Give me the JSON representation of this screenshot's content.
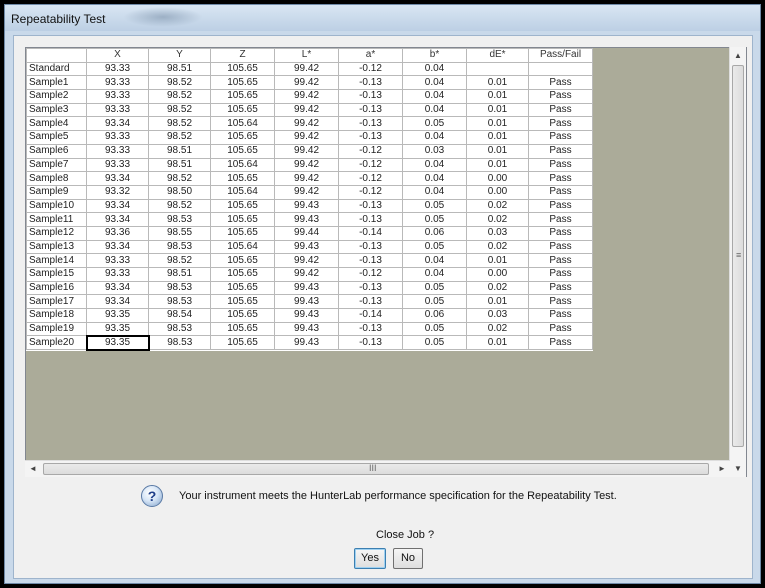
{
  "window": {
    "title": "Repeatability Test"
  },
  "table": {
    "columns": [
      "X",
      "Y",
      "Z",
      "L*",
      "a*",
      "b*",
      "dE*",
      "Pass/Fail"
    ],
    "rows": [
      {
        "label": "Standard",
        "cells": [
          "93.33",
          "98.51",
          "105.65",
          "99.42",
          "-0.12",
          "0.04",
          "",
          ""
        ]
      },
      {
        "label": "Sample1",
        "cells": [
          "93.33",
          "98.52",
          "105.65",
          "99.42",
          "-0.13",
          "0.04",
          "0.01",
          "Pass"
        ]
      },
      {
        "label": "Sample2",
        "cells": [
          "93.33",
          "98.52",
          "105.65",
          "99.42",
          "-0.13",
          "0.04",
          "0.01",
          "Pass"
        ]
      },
      {
        "label": "Sample3",
        "cells": [
          "93.33",
          "98.52",
          "105.65",
          "99.42",
          "-0.13",
          "0.04",
          "0.01",
          "Pass"
        ]
      },
      {
        "label": "Sample4",
        "cells": [
          "93.34",
          "98.52",
          "105.64",
          "99.42",
          "-0.13",
          "0.05",
          "0.01",
          "Pass"
        ]
      },
      {
        "label": "Sample5",
        "cells": [
          "93.33",
          "98.52",
          "105.65",
          "99.42",
          "-0.13",
          "0.04",
          "0.01",
          "Pass"
        ]
      },
      {
        "label": "Sample6",
        "cells": [
          "93.33",
          "98.51",
          "105.65",
          "99.42",
          "-0.12",
          "0.03",
          "0.01",
          "Pass"
        ]
      },
      {
        "label": "Sample7",
        "cells": [
          "93.33",
          "98.51",
          "105.64",
          "99.42",
          "-0.12",
          "0.04",
          "0.01",
          "Pass"
        ]
      },
      {
        "label": "Sample8",
        "cells": [
          "93.34",
          "98.52",
          "105.65",
          "99.42",
          "-0.12",
          "0.04",
          "0.00",
          "Pass"
        ]
      },
      {
        "label": "Sample9",
        "cells": [
          "93.32",
          "98.50",
          "105.64",
          "99.42",
          "-0.12",
          "0.04",
          "0.00",
          "Pass"
        ]
      },
      {
        "label": "Sample10",
        "cells": [
          "93.34",
          "98.52",
          "105.65",
          "99.43",
          "-0.13",
          "0.05",
          "0.02",
          "Pass"
        ]
      },
      {
        "label": "Sample11",
        "cells": [
          "93.34",
          "98.53",
          "105.65",
          "99.43",
          "-0.13",
          "0.05",
          "0.02",
          "Pass"
        ]
      },
      {
        "label": "Sample12",
        "cells": [
          "93.36",
          "98.55",
          "105.65",
          "99.44",
          "-0.14",
          "0.06",
          "0.03",
          "Pass"
        ]
      },
      {
        "label": "Sample13",
        "cells": [
          "93.34",
          "98.53",
          "105.64",
          "99.43",
          "-0.13",
          "0.05",
          "0.02",
          "Pass"
        ]
      },
      {
        "label": "Sample14",
        "cells": [
          "93.33",
          "98.52",
          "105.65",
          "99.42",
          "-0.13",
          "0.04",
          "0.01",
          "Pass"
        ]
      },
      {
        "label": "Sample15",
        "cells": [
          "93.33",
          "98.51",
          "105.65",
          "99.42",
          "-0.12",
          "0.04",
          "0.00",
          "Pass"
        ]
      },
      {
        "label": "Sample16",
        "cells": [
          "93.34",
          "98.53",
          "105.65",
          "99.43",
          "-0.13",
          "0.05",
          "0.02",
          "Pass"
        ]
      },
      {
        "label": "Sample17",
        "cells": [
          "93.34",
          "98.53",
          "105.65",
          "99.43",
          "-0.13",
          "0.05",
          "0.01",
          "Pass"
        ]
      },
      {
        "label": "Sample18",
        "cells": [
          "93.35",
          "98.54",
          "105.65",
          "99.43",
          "-0.14",
          "0.06",
          "0.03",
          "Pass"
        ]
      },
      {
        "label": "Sample19",
        "cells": [
          "93.35",
          "98.53",
          "105.65",
          "99.43",
          "-0.13",
          "0.05",
          "0.02",
          "Pass"
        ]
      },
      {
        "label": "Sample20",
        "cells": [
          "93.35",
          "98.53",
          "105.65",
          "99.43",
          "-0.13",
          "0.05",
          "0.01",
          "Pass"
        ]
      }
    ]
  },
  "scrollbars": {
    "vertical_grip": "≡",
    "horizontal_grip": "III",
    "up": "▲",
    "down": "▼",
    "left": "◄",
    "right": "►"
  },
  "message": {
    "icon": "question-icon",
    "icon_glyph": "?",
    "text": "Your instrument meets the HunterLab performance specification for the Repeatability Test.",
    "prompt": "Close Job ?"
  },
  "buttons": {
    "yes": "Yes",
    "no": "No"
  }
}
